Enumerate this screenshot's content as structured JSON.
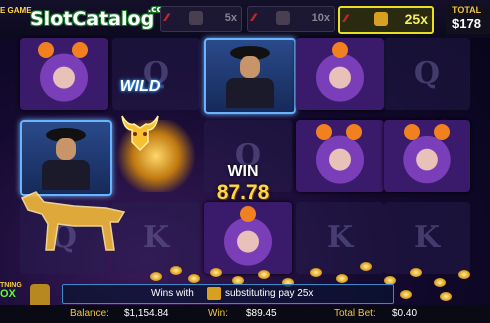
{
  "topbar": {
    "left_label": "E GAME",
    "logo_text": "SlotCatalog",
    "logo_suffix": ".com",
    "multipliers": [
      {
        "label": "5x",
        "active": false
      },
      {
        "label": "10x",
        "active": false
      },
      {
        "label": "25x",
        "active": true
      }
    ],
    "total_label": "TOTAL",
    "total_value": "$178"
  },
  "reels": {
    "empty_symbols": [
      "Q",
      "K",
      "Q",
      "K",
      "K",
      "Q"
    ],
    "wild_label": "WILD"
  },
  "win_display": {
    "label": "WIN",
    "amount": "87.78"
  },
  "bottom": {
    "feature_badge_top": "TNING",
    "feature_badge_bottom": "OX",
    "message_prefix": "Wins with",
    "message_suffix": "substituting pay 25x"
  },
  "status": {
    "balance_label": "Balance:",
    "balance_value": "$1,154.84",
    "win_label": "Win:",
    "win_value": "$89.45",
    "total_bet_label": "Total Bet:",
    "total_bet_value": "$0.40"
  },
  "colors": {
    "accent_gold": "#ffd54a",
    "active_multiplier": "#e8e020",
    "wild_glow": "#3aa8ff"
  },
  "icons": [
    "bull-icon",
    "dollar-bag-icon",
    "coin-icon"
  ]
}
